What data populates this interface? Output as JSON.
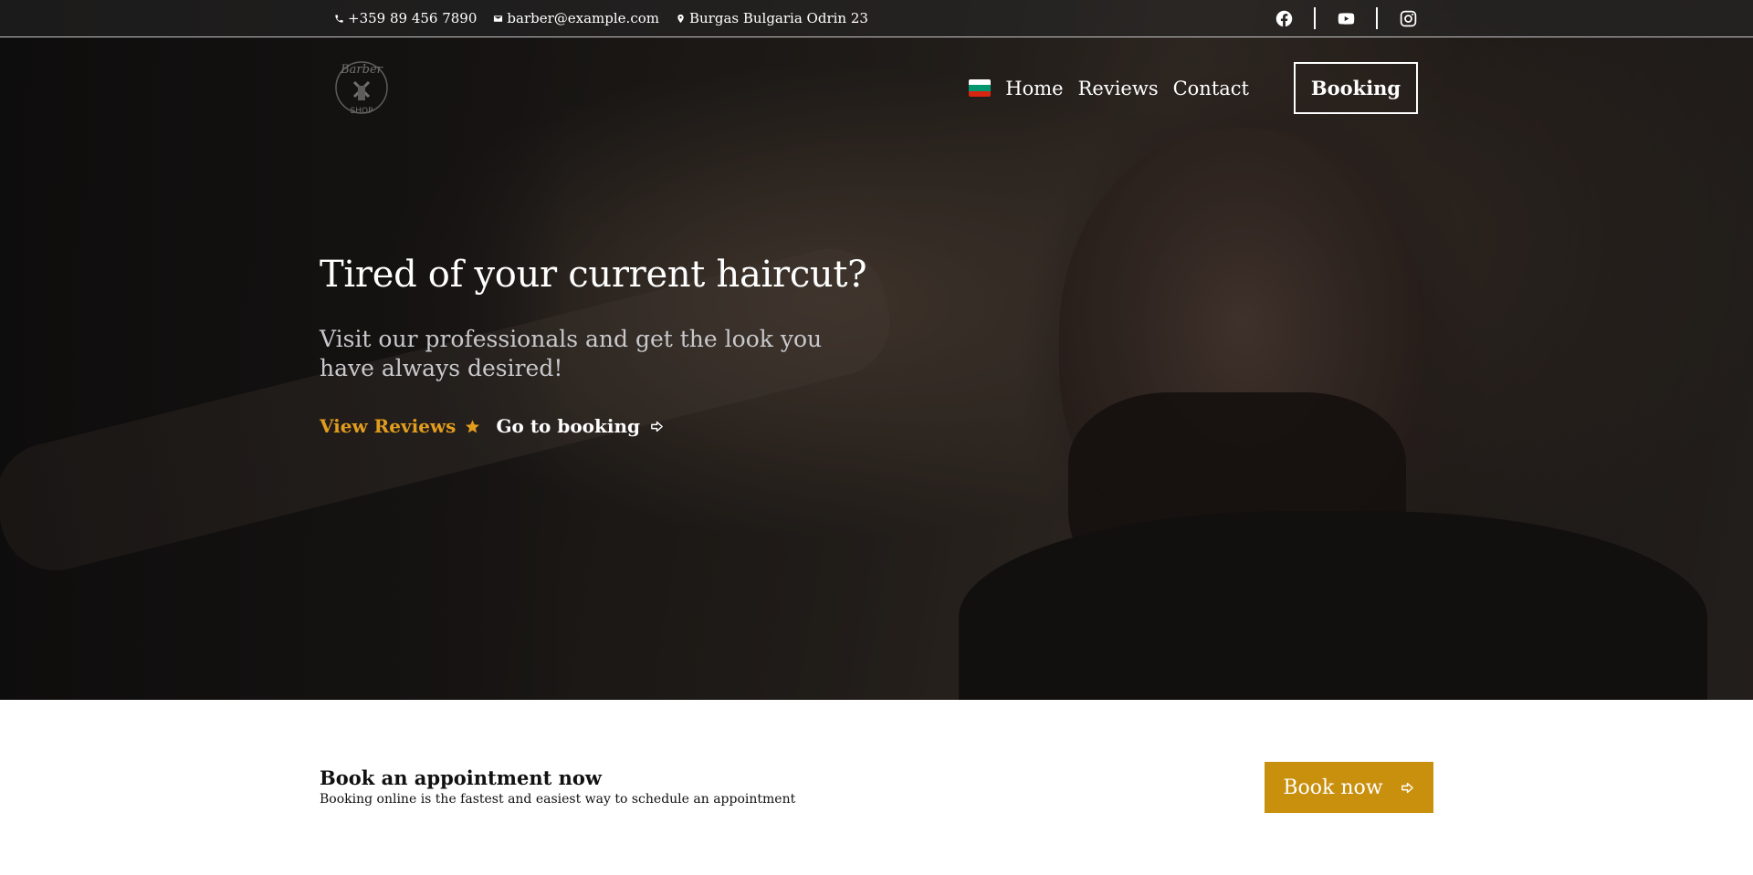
{
  "topbar": {
    "phone": "+359 89 456 7890",
    "email": "barber@example.com",
    "address": "Burgas Bulgaria Odrin 23",
    "social": [
      "facebook-icon",
      "youtube-icon",
      "instagram-icon"
    ]
  },
  "logo": {
    "line1": "Barber",
    "line2": "SHOP"
  },
  "nav": {
    "flag": "bulgaria-flag-icon",
    "flag_colors": [
      "#ffffff",
      "#00966e",
      "#d62612"
    ],
    "links": [
      "Home",
      "Reviews",
      "Contact"
    ],
    "booking_label": "Booking"
  },
  "hero": {
    "title": "Tired of your current haircut?",
    "subtitle": "Visit our professionals and get the look you have always desired!",
    "reviews_link": "View Reviews",
    "booking_link": "Go to booking",
    "accent_color": "#e39d1d"
  },
  "appointment": {
    "title": "Book an appointment now",
    "text": "Booking online is the fastest and easiest way to schedule an appointment",
    "button_label": "Book now",
    "button_color": "#c9900e"
  }
}
